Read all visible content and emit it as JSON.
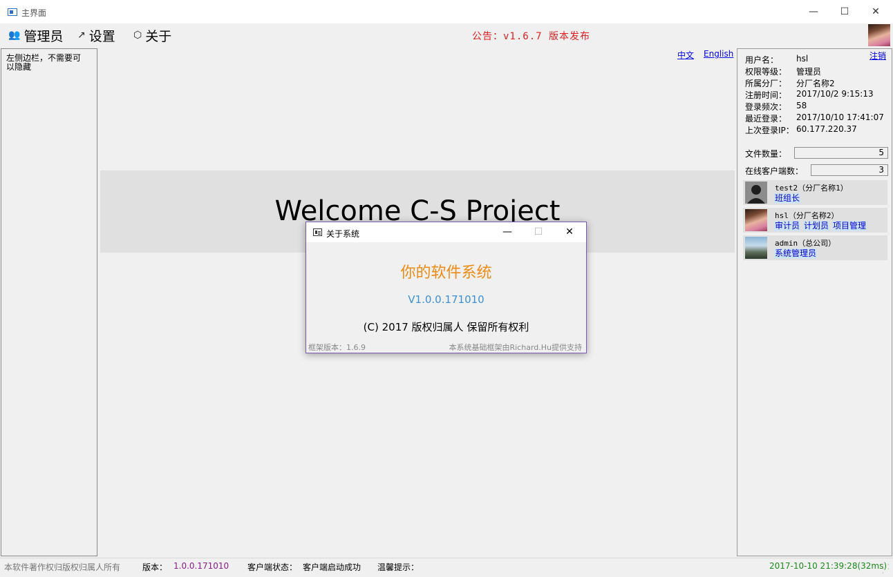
{
  "window": {
    "title": "主界面",
    "min_glyph": "—",
    "max_glyph": "☐",
    "close_glyph": "✕"
  },
  "menu": {
    "admin": {
      "label": "管理员",
      "icon": "users-icon",
      "glyph": "👥"
    },
    "settings": {
      "label": "设置",
      "icon": "arrow-icon",
      "glyph": "↗"
    },
    "about": {
      "label": "关于",
      "icon": "cube-icon",
      "glyph": "⬡"
    }
  },
  "announcement": "公告：v1.6.7 版本发布",
  "sidebar": {
    "note": "左侧边栏，不需要可以隐藏"
  },
  "language": {
    "chinese": "中文",
    "english": "English"
  },
  "main": {
    "welcome": "Welcome C-S Project"
  },
  "user_panel": {
    "logout": "注销",
    "fields": [
      {
        "label": "用户名：",
        "value": "hsl"
      },
      {
        "label": "权限等级：",
        "value": "管理员"
      },
      {
        "label": "所属分厂：",
        "value": "分厂名称2"
      },
      {
        "label": "注册时间：",
        "value": "2017/10/2 9:15:13"
      },
      {
        "label": "登录频次：",
        "value": "58"
      },
      {
        "label": "最近登录：",
        "value": "2017/10/10 17:41:07"
      },
      {
        "label": "上次登录IP：",
        "value": "60.177.220.37"
      }
    ],
    "file_count_label": "文件数量：",
    "file_count": "5",
    "online_clients_label": "在线客户端数：",
    "online_clients": "3"
  },
  "clients": [
    {
      "name": "test2（分厂名称1）",
      "roles": [
        "班组长"
      ],
      "avatar": "default-avatar"
    },
    {
      "name": "hsl（分厂名称2）",
      "roles": [
        "审计员",
        "计划员",
        "项目管理"
      ],
      "avatar": "photo-avatar"
    },
    {
      "name": "admin（总公司）",
      "roles": [
        "系统管理员"
      ],
      "avatar": "photo-avatar"
    }
  ],
  "dialog": {
    "title": "关于系统",
    "product": "你的软件系统",
    "version": "V1.0.0.171010",
    "copyright": "(C) 2017 版权归属人 保留所有权利",
    "framework_version": "框架版本：1.6.9",
    "support": "本系统基础框架由Richard.Hu提供支持"
  },
  "statusbar": {
    "copyright": "本软件著作权归版权归属人所有",
    "version_label": "版本：",
    "version_value": "1.0.0.171010",
    "client_status_label": "客户端状态：",
    "client_status_value": "客户端启动成功",
    "tip_label": "温馨提示：",
    "datetime": "2017-10-10 21:39:28(32ms)"
  },
  "colors": {
    "announcement": "#e02020",
    "product": "#f08a12",
    "version": "#3a8fd8",
    "link": "#0000ee",
    "datetime": "#1a8a1a"
  }
}
